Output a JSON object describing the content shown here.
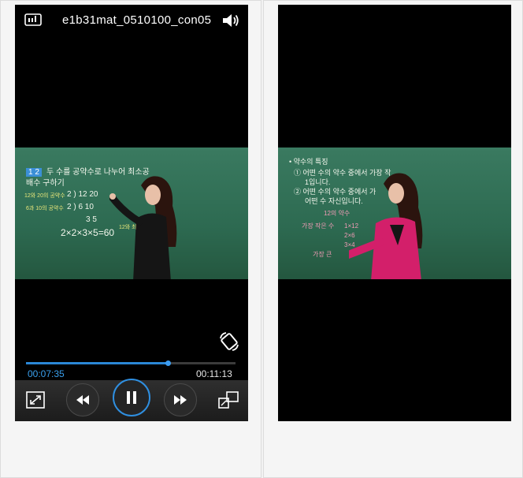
{
  "player": {
    "title": "e1b31mat_0510100_con05",
    "time_current": "00:07:35",
    "time_total": "00:11:13",
    "progress": 0.676,
    "icons": {
      "subtitle": "subtitle-icon",
      "volume": "volume-icon",
      "rotate": "rotate-screen-icon",
      "fullscreen": "fullscreen-icon",
      "rewind": "rewind-icon",
      "pause": "pause-icon",
      "forward": "fast-forward-icon",
      "pip": "picture-in-picture-icon"
    }
  },
  "left_board": {
    "line1_num": "1 2",
    "line1": "두 수를 공약수로 나누어 최소공",
    "line2": "배수 구하기",
    "label_a": "12와 20의 공약수",
    "label_b": "6과 10의 공약수",
    "row1": "2 ) 12  20",
    "row2": "2 )  6  10",
    "row3": "3   5",
    "formula": "2×2×3×5=60",
    "note": "12와 최소"
  },
  "right_board": {
    "heading": "• 약수의 특징",
    "item1": "① 어떤 수의 약수 중에서 가장 작",
    "item1b": "1입니다.",
    "item2": "② 어떤 수의 약수 중에서 가",
    "item2b": "어떤 수 자신입니다.",
    "note1": "12의 약수",
    "note2": "가장 작은 수",
    "note3": "1×12",
    "note4": "2×6",
    "note5": "3×4",
    "note6": "가장 큰"
  },
  "colors": {
    "accent": "#2f8fe0",
    "board": "#2f6a52"
  }
}
